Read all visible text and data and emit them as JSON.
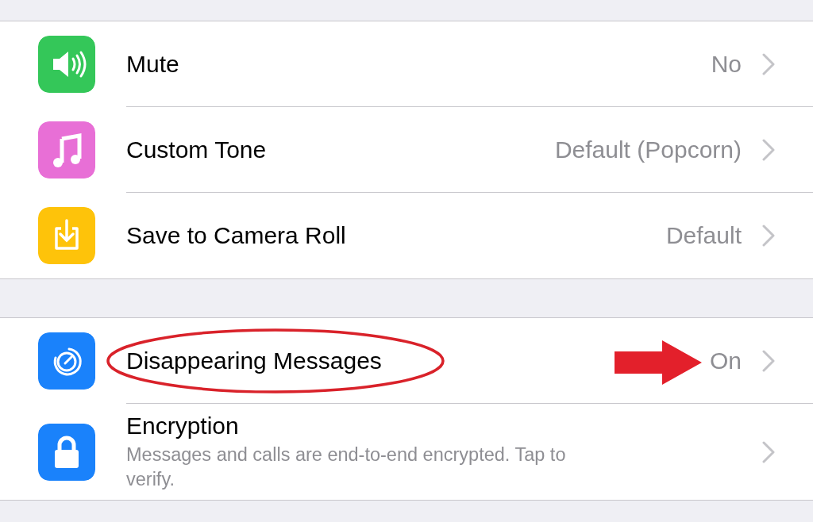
{
  "groups": [
    {
      "rows": [
        {
          "kind": "setting",
          "label": "Mute",
          "value": "No",
          "color": "#34c759"
        },
        {
          "kind": "setting",
          "label": "Custom Tone",
          "value": "Default (Popcorn)",
          "color": "#e86fd6"
        },
        {
          "kind": "setting",
          "label": "Save to Camera Roll",
          "value": "Default",
          "color": "#fec30a"
        }
      ]
    },
    {
      "rows": [
        {
          "kind": "setting",
          "label": "Disappearing Messages",
          "value": "On",
          "color": "#1a82fb",
          "circled": true,
          "arrow": true
        },
        {
          "kind": "detail",
          "label": "Encryption",
          "subtitle": "Messages and calls are end-to-end encrypted. Tap to verify.",
          "color": "#1a82fb"
        }
      ]
    }
  ]
}
